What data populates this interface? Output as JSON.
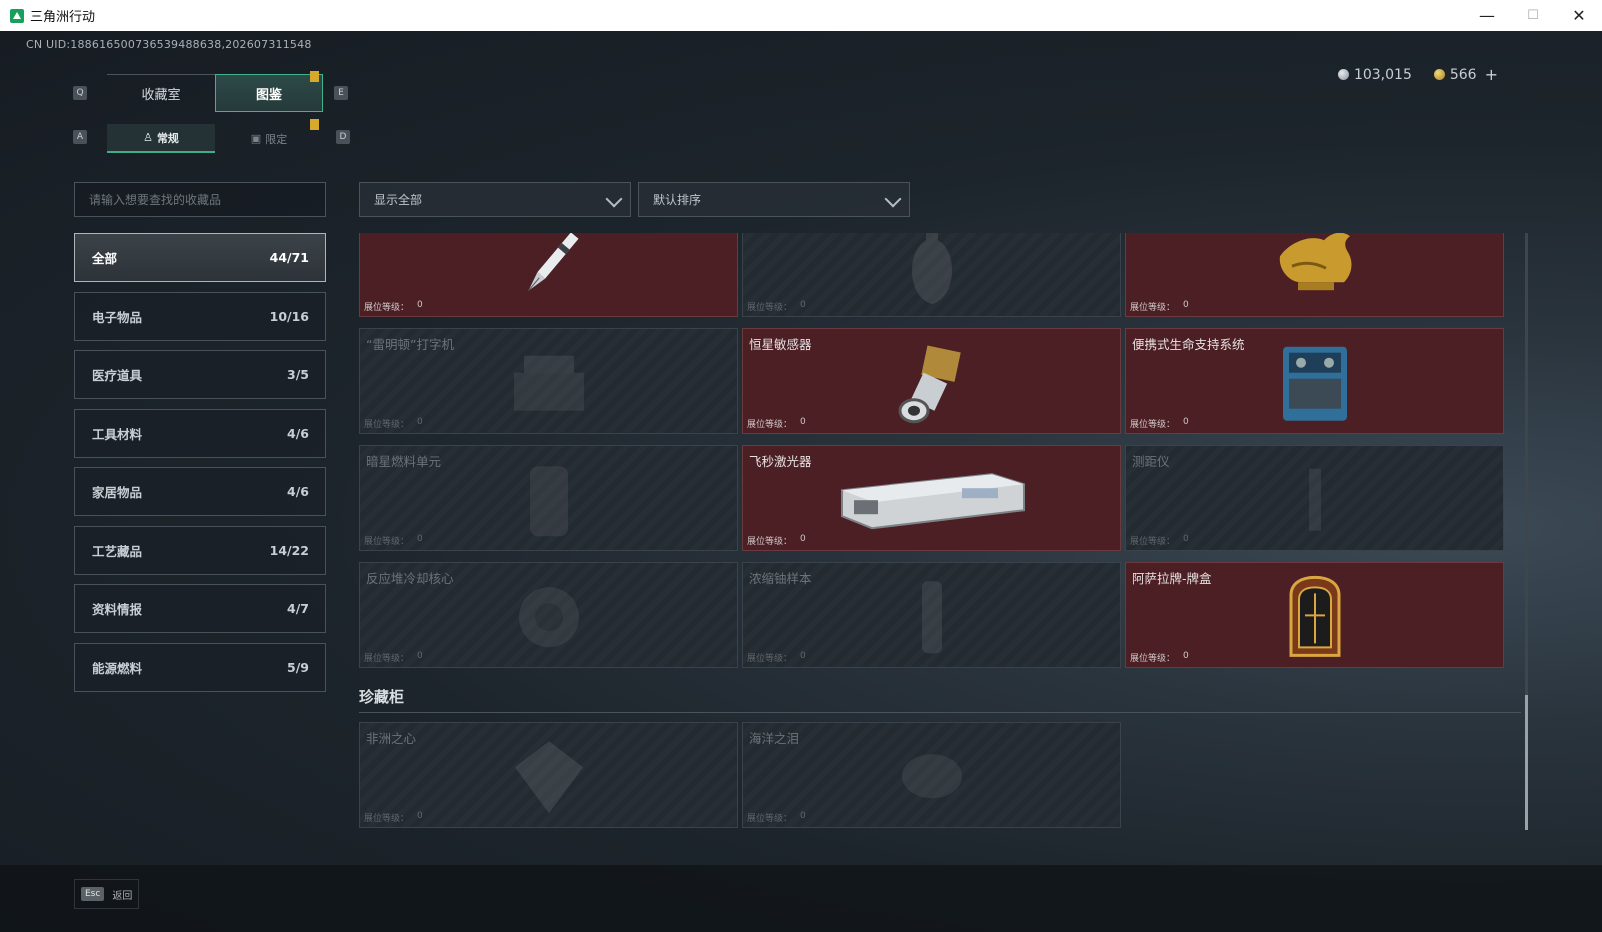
{
  "window": {
    "title": "三角洲行动",
    "min": "—",
    "max": "☐",
    "close": "✕"
  },
  "uid": "CN UID:18861650073653948863​8,202607311548",
  "currency": {
    "silver": "103,015",
    "gold": "566",
    "plus": "+"
  },
  "keys": {
    "q": "Q",
    "e": "E",
    "a": "A",
    "d": "D"
  },
  "tabs": [
    {
      "label": "收藏室"
    },
    {
      "label": "图鉴"
    }
  ],
  "subtabs": [
    {
      "label": "常规"
    },
    {
      "label": "限定"
    }
  ],
  "search": {
    "placeholder": "请输入想要查找的收藏品"
  },
  "filters": {
    "show": "显示全部",
    "sort": "默认排序"
  },
  "categories": [
    {
      "label": "全部",
      "count": "44/71"
    },
    {
      "label": "电子物品",
      "count": "10/16"
    },
    {
      "label": "医疗道具",
      "count": "3/5"
    },
    {
      "label": "工具材料",
      "count": "4/6"
    },
    {
      "label": "家居物品",
      "count": "4/6"
    },
    {
      "label": "工艺藏品",
      "count": "14/22"
    },
    {
      "label": "资料情报",
      "count": "4/7"
    },
    {
      "label": "能源燃料",
      "count": "5/9"
    }
  ],
  "level_label": "展位等级：",
  "items": [
    {
      "name": "",
      "level": "0",
      "owned": true,
      "icon": "pen-icon"
    },
    {
      "name": "",
      "level": "0",
      "owned": false,
      "icon": "vase-icon"
    },
    {
      "name": "",
      "level": "0",
      "owned": true,
      "icon": "gold-statue-icon"
    },
    {
      "name": "“雷明顿”打字机",
      "level": "0",
      "owned": false,
      "icon": "typewriter-icon"
    },
    {
      "name": "恒星敏感器",
      "level": "0",
      "owned": true,
      "icon": "star-sensor-icon"
    },
    {
      "name": "便携式生命支持系统",
      "level": "0",
      "owned": true,
      "icon": "life-support-icon"
    },
    {
      "name": "暗星燃料单元",
      "level": "0",
      "owned": false,
      "icon": "fuel-cell-icon"
    },
    {
      "name": "飞秒激光器",
      "level": "0",
      "owned": true,
      "icon": "laser-icon"
    },
    {
      "name": "测距仪",
      "level": "0",
      "owned": false,
      "icon": "rangefinder-icon"
    },
    {
      "name": "反应堆冷却核心",
      "level": "0",
      "owned": false,
      "icon": "reactor-core-icon"
    },
    {
      "name": "浓缩铀样本",
      "level": "0",
      "owned": false,
      "icon": "uranium-sample-icon"
    },
    {
      "name": "阿萨拉牌-牌盒",
      "level": "0",
      "owned": true,
      "icon": "card-box-icon"
    }
  ],
  "cabinet": {
    "title": "珍藏柜",
    "items": [
      {
        "name": "非洲之心",
        "level": "0",
        "owned": false,
        "icon": "diamond-icon"
      },
      {
        "name": "海洋之泪",
        "level": "0",
        "owned": false,
        "icon": "gem-icon"
      }
    ]
  },
  "footer": {
    "esc_key": "Esc",
    "back": "返回"
  }
}
